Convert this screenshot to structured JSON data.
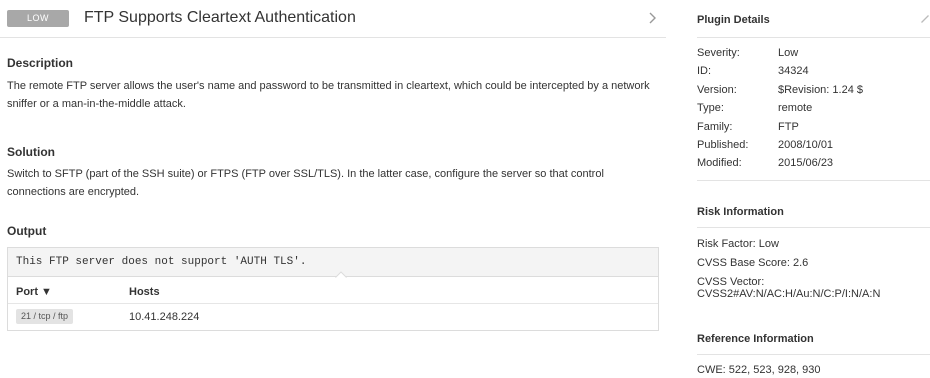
{
  "header": {
    "severity_badge": "LOW",
    "title": "FTP Supports Cleartext Authentication"
  },
  "description": {
    "heading": "Description",
    "text": "The remote FTP server allows the user's name and password to be transmitted in cleartext, which could be intercepted by a network sniffer or a man-in-the-middle attack."
  },
  "solution": {
    "heading": "Solution",
    "text": "Switch to SFTP (part of the SSH suite) or FTPS (FTP over SSL/TLS). In the latter case, configure the server so that control connections are encrypted."
  },
  "output": {
    "heading": "Output",
    "code": "This FTP server does not support 'AUTH TLS'.",
    "columns": {
      "port": "Port ▼",
      "hosts": "Hosts"
    },
    "rows": [
      {
        "port": "21 / tcp / ftp",
        "host": "10.41.248.224"
      }
    ]
  },
  "plugin_details": {
    "heading": "Plugin Details",
    "items": [
      {
        "label": "Severity:",
        "value": "Low"
      },
      {
        "label": "ID:",
        "value": "34324"
      },
      {
        "label": "Version:",
        "value": "$Revision: 1.24 $"
      },
      {
        "label": "Type:",
        "value": "remote"
      },
      {
        "label": "Family:",
        "value": "FTP"
      },
      {
        "label": "Published:",
        "value": "2008/10/01"
      },
      {
        "label": "Modified:",
        "value": "2015/06/23"
      }
    ]
  },
  "risk_information": {
    "heading": "Risk Information",
    "risk_factor": "Risk Factor:  Low",
    "cvss_base": "CVSS Base Score:  2.6",
    "cvss_vector": "CVSS Vector:  CVSS2#AV:N/AC:H/Au:N/C:P/I:N/A:N"
  },
  "reference_information": {
    "heading": "Reference Information",
    "cwe": "CWE:  522, 523, 928, 930"
  },
  "icons": {
    "next": "chevron-right-icon",
    "edit": "pencil-icon",
    "sort": "sort-down-icon"
  },
  "colors": {
    "badge_bg": "#a8a8a8",
    "code_bg": "#f4f4f4",
    "pill_bg": "#e3e3e3"
  }
}
